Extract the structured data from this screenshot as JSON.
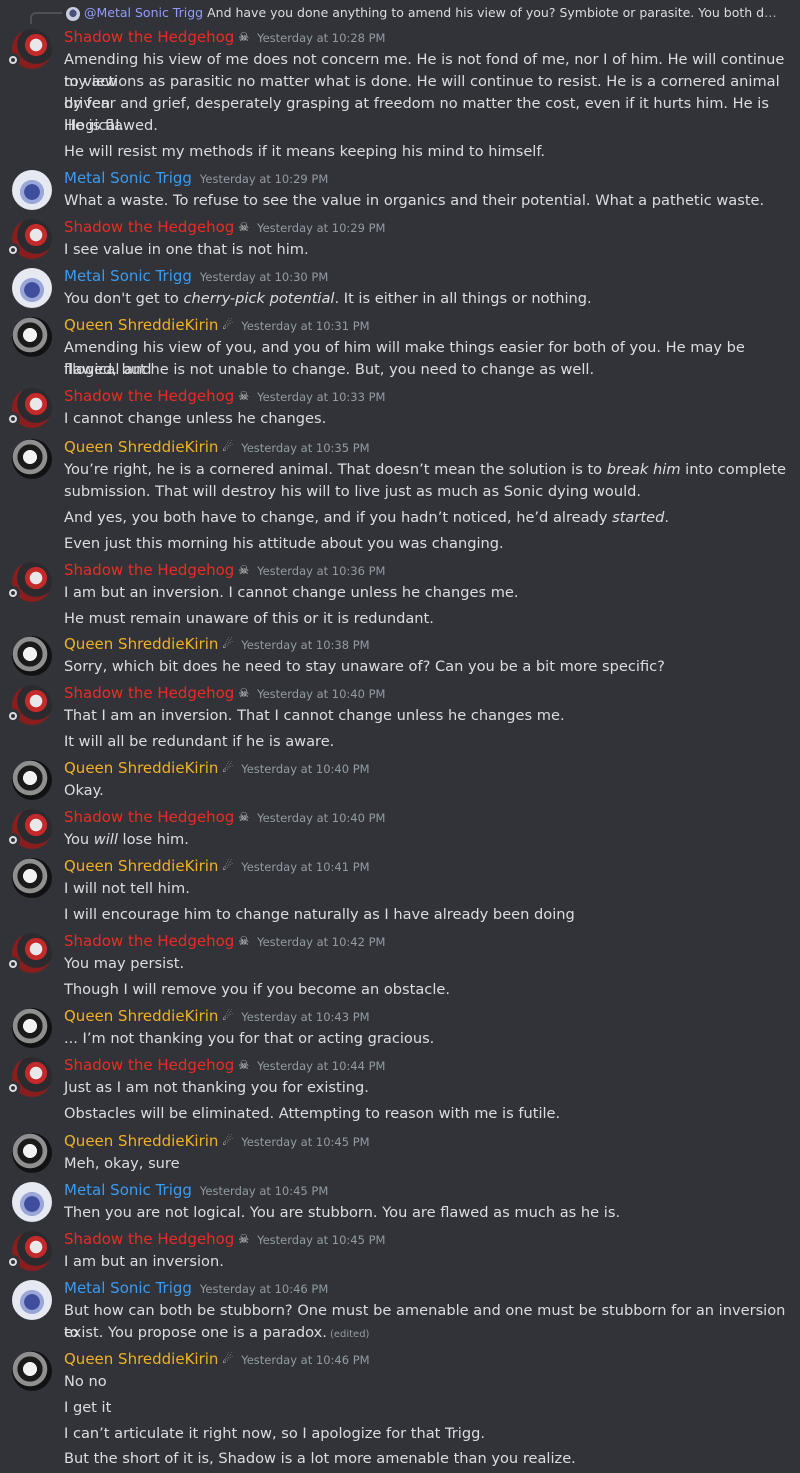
{
  "reply": {
    "mention": "@Metal Sonic Trigg",
    "text": "And have you done anything to amend his view of you? Symbiote or parasite. You both decide w..."
  },
  "icons": {
    "shadow_tag": "☠",
    "queen_tag": "☄"
  },
  "colors": {
    "shadow": "#ed2b24",
    "metal": "#3b9bf0",
    "queen": "#f1b124",
    "background": "#313338"
  },
  "messages": [
    {
      "author": "Shadow the Hedgehog",
      "time": "Yesterday at 10:28 PM",
      "lines": [
        "Amending his view of me does not concern me. He is not fond of me, nor I of him. He will continue to view",
        "my actions as parasitic no matter what is done. He will continue to resist. He is a cornered animal driven",
        "by fear and grief, desperately grasping at freedom no matter the cost, even if it hurts him. He is illogical.",
        "He is flawed.",
        "He will resist my methods if it means keeping his mind to himself."
      ]
    },
    {
      "author": "Metal Sonic Trigg",
      "time": "Yesterday at 10:29 PM",
      "lines": [
        "What a waste. To refuse to see the value in organics and their potential. What a pathetic waste."
      ]
    },
    {
      "author": "Shadow the Hedgehog",
      "time": "Yesterday at 10:29 PM",
      "lines": [
        "I see value in one that is not him."
      ]
    },
    {
      "author": "Metal Sonic Trigg",
      "time": "Yesterday at 10:30 PM",
      "lines": [
        "You don't get to cherry-pick potential. It is either in all things or nothing."
      ]
    },
    {
      "author": "Queen ShreddieKirin",
      "time": "Yesterday at 10:31 PM",
      "lines": [
        "Amending his view of you, and you of him will make things easier for both of you. He may be illogical and",
        "flawed, but he is not unable to change. But, you need to change as well."
      ]
    },
    {
      "author": "Shadow the Hedgehog",
      "time": "Yesterday at 10:33 PM",
      "lines": [
        "I cannot change unless he changes."
      ]
    },
    {
      "author": "Queen ShreddieKirin",
      "time": "Yesterday at 10:35 PM",
      "lines": [
        "You’re right, he is a cornered animal. That doesn’t mean the solution is to break him into complete",
        "submission. That will destroy his will to live just as much as Sonic dying would.",
        "And yes, you both have to change, and if you hadn’t noticed, he’d already started.",
        "Even just this morning his attitude about you was changing."
      ]
    },
    {
      "author": "Shadow the Hedgehog",
      "time": "Yesterday at 10:36 PM",
      "lines": [
        "I am but an inversion. I cannot change unless he changes me.",
        "He must remain unaware of this or it is redundant."
      ]
    },
    {
      "author": "Queen ShreddieKirin",
      "time": "Yesterday at 10:38 PM",
      "lines": [
        "Sorry, which bit does he need to stay unaware of? Can you be a bit more specific?"
      ]
    },
    {
      "author": "Shadow the Hedgehog",
      "time": "Yesterday at 10:40 PM",
      "lines": [
        "That I am an inversion. That I cannot change unless he changes me.",
        "It will all be redundant if he is aware."
      ]
    },
    {
      "author": "Queen ShreddieKirin",
      "time": "Yesterday at 10:40 PM",
      "lines": [
        "Okay."
      ]
    },
    {
      "author": "Shadow the Hedgehog",
      "time": "Yesterday at 10:40 PM",
      "lines": [
        "You will lose him."
      ]
    },
    {
      "author": "Queen ShreddieKirin",
      "time": "Yesterday at 10:41 PM",
      "lines": [
        "I will not tell him.",
        "I will encourage him to change naturally as I have already been doing"
      ]
    },
    {
      "author": "Shadow the Hedgehog",
      "time": "Yesterday at 10:42 PM",
      "lines": [
        "You may persist.",
        "Though I will remove you if you become an obstacle."
      ]
    },
    {
      "author": "Queen ShreddieKirin",
      "time": "Yesterday at 10:43 PM",
      "lines": [
        "... I’m not thanking you for that or acting gracious."
      ]
    },
    {
      "author": "Shadow the Hedgehog",
      "time": "Yesterday at 10:44 PM",
      "lines": [
        "Just as I am not thanking you for existing.",
        "Obstacles will be eliminated. Attempting to reason with me is futile."
      ]
    },
    {
      "author": "Queen ShreddieKirin",
      "time": "Yesterday at 10:45 PM",
      "lines": [
        "Meh, okay, sure"
      ]
    },
    {
      "author": "Metal Sonic Trigg",
      "time": "Yesterday at 10:45 PM",
      "lines": [
        "Then you are not logical. You are stubborn. You are flawed as much as he is."
      ]
    },
    {
      "author": "Shadow the Hedgehog",
      "time": "Yesterday at 10:45 PM",
      "lines": [
        "I am but an inversion."
      ]
    },
    {
      "author": "Metal Sonic Trigg",
      "time": "Yesterday at 10:46 PM",
      "lines": [
        "But how can both be stubborn? One must be  amenable and one must be stubborn for an inversion to",
        "exist. You propose one is a paradox."
      ],
      "edited": "(edited)"
    },
    {
      "author": "Queen ShreddieKirin",
      "time": "Yesterday at 10:46 PM",
      "lines": [
        "No no",
        "I get it",
        "I can’t articulate it right now, so I apologize for that Trigg.",
        "But the short of it is, Shadow is a lot more amenable than you realize."
      ]
    }
  ]
}
